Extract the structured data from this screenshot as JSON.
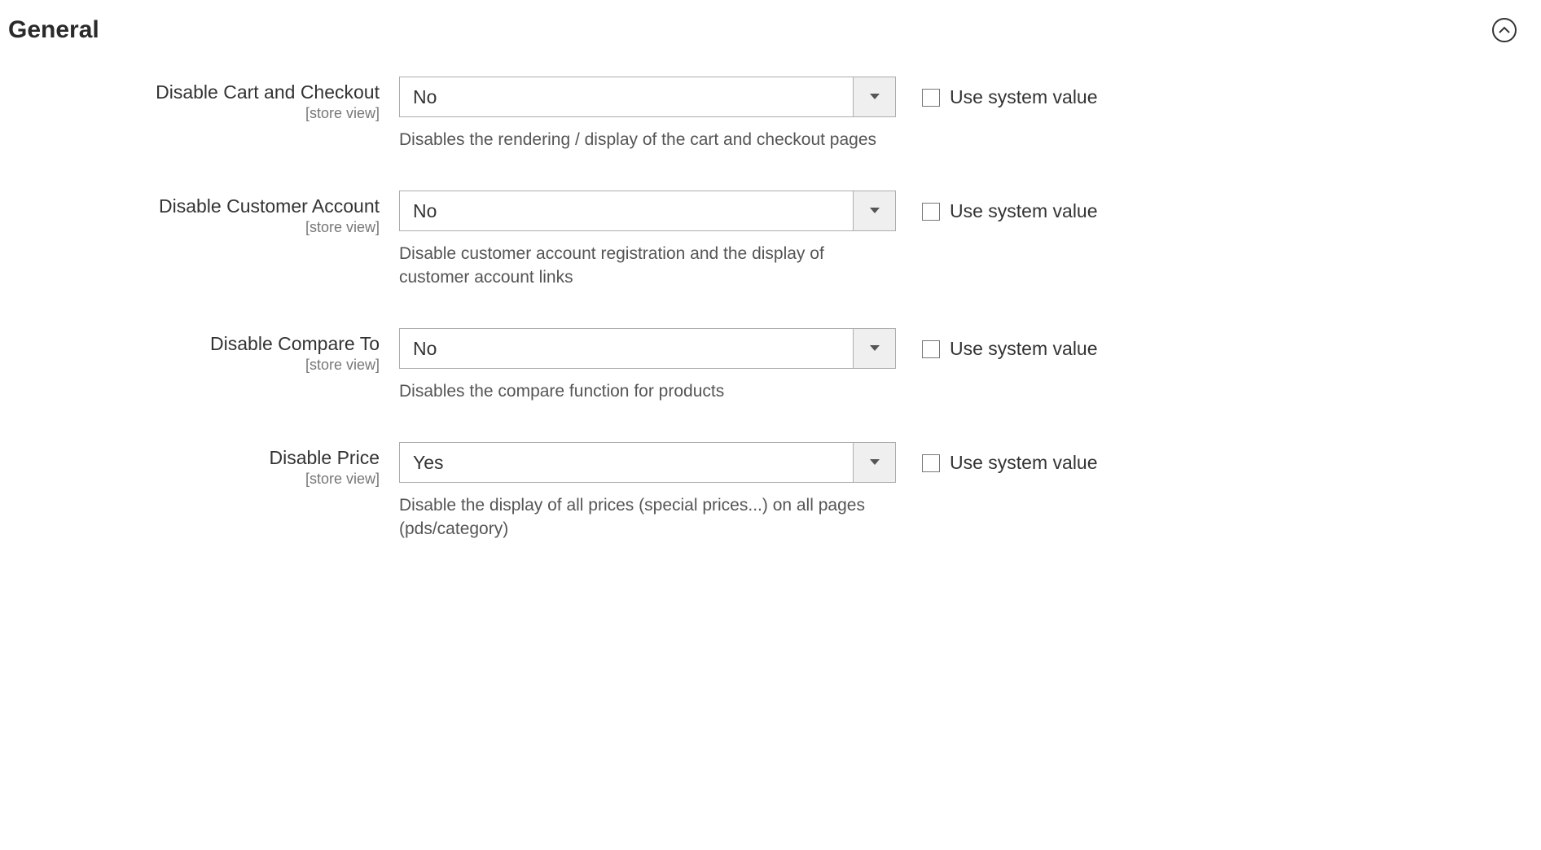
{
  "section": {
    "title": "General"
  },
  "common": {
    "scope": "[store view]",
    "use_system_value": "Use system value"
  },
  "fields": {
    "disable_cart": {
      "label": "Disable Cart and Checkout",
      "value": "No",
      "note": "Disables the rendering / display of the cart and checkout pages"
    },
    "disable_customer_account": {
      "label": "Disable Customer Account",
      "value": "No",
      "note": "Disable customer account registration and the display of customer account links"
    },
    "disable_compare": {
      "label": "Disable Compare To",
      "value": "No",
      "note": "Disables the compare function for products"
    },
    "disable_price": {
      "label": "Disable Price",
      "value": "Yes",
      "note": "Disable the display of all prices (special prices...) on all pages (pds/category)"
    }
  }
}
